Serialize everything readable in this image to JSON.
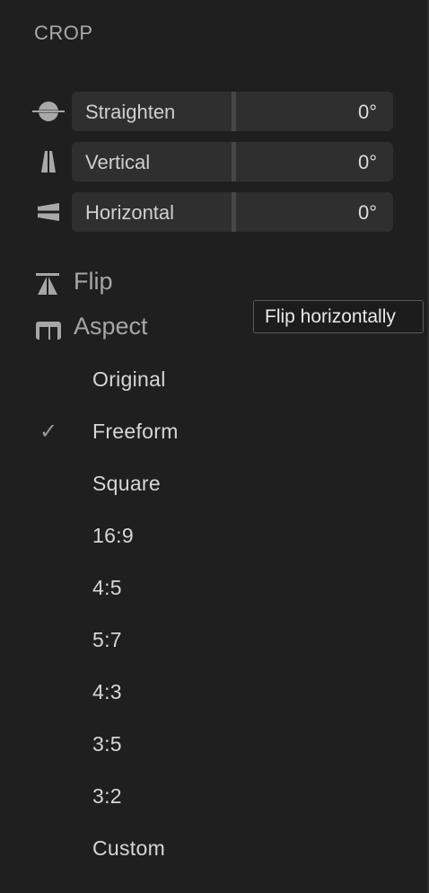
{
  "panel": {
    "section_title": "CROP"
  },
  "adjustments": [
    {
      "label": "Straighten",
      "value": "0°",
      "icon": "straighten-icon"
    },
    {
      "label": "Vertical",
      "value": "0°",
      "icon": "vertical-perspective-icon"
    },
    {
      "label": "Horizontal",
      "value": "0°",
      "icon": "horizontal-perspective-icon"
    }
  ],
  "tools": {
    "flip": {
      "label": "Flip",
      "icon": "flip-icon"
    },
    "aspect": {
      "label": "Aspect",
      "icon": "aspect-icon"
    }
  },
  "tooltip": {
    "text": "Flip horizontally"
  },
  "aspect_options": {
    "selected": "Freeform",
    "check_glyph": "✓",
    "items": [
      "Original",
      "Freeform",
      "Square",
      "16:9",
      "4:5",
      "5:7",
      "4:3",
      "3:5",
      "3:2",
      "Custom"
    ]
  },
  "colors": {
    "background": "#1f1f1f",
    "slider_bg": "#2f2f2f",
    "slider_divider": "#474747",
    "text": "#cfcfcf",
    "muted": "#a6a6a6"
  }
}
